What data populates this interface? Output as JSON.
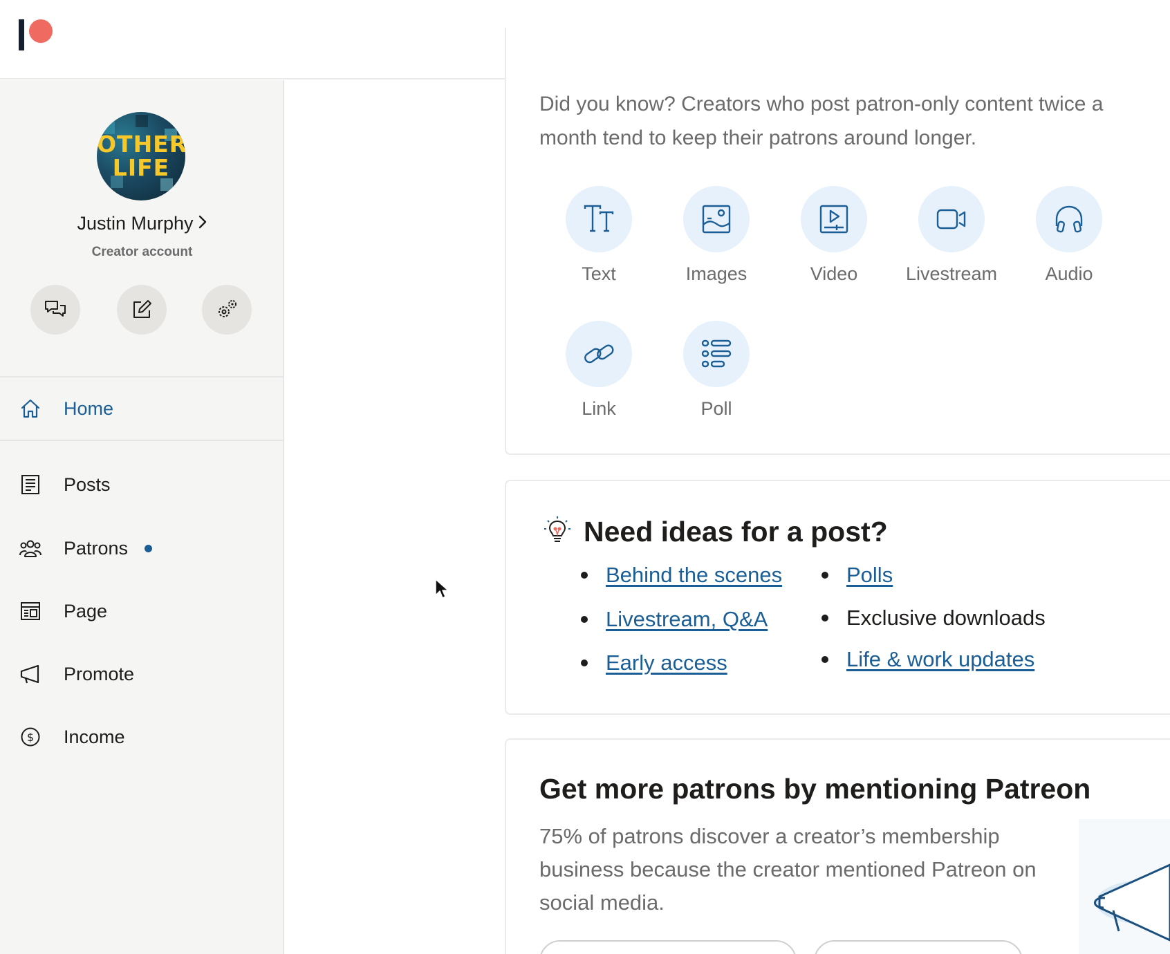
{
  "user": {
    "name": "Justin Murphy",
    "role": "Creator account",
    "avatar_text_line1": "OTHER",
    "avatar_text_line2": "LIFE"
  },
  "quick_actions": [
    "messages-icon",
    "edit-icon",
    "settings-icon"
  ],
  "nav": {
    "home": "Home",
    "posts": "Posts",
    "patrons": "Patrons",
    "page": "Page",
    "promote": "Promote",
    "income": "Income"
  },
  "create": {
    "did_you_know": "Did you know? Creators who post patron-only content twice a month tend to keep their patrons around longer.",
    "types": [
      "Text",
      "Images",
      "Video",
      "Livestream",
      "Audio",
      "Link",
      "Poll"
    ]
  },
  "ideas": {
    "title": "Need ideas for a post?",
    "items": [
      "Behind the scenes",
      "Livestream, Q&A",
      "Early access",
      "Polls",
      "Exclusive downloads",
      "Life & work updates"
    ]
  },
  "mention": {
    "title": "Get more patrons by mentioning Patreon",
    "body": "75% of patrons discover a creator’s membership business because the creator mentioned Patreon on social media."
  },
  "colors": {
    "accent": "#1b5e95",
    "brand_dot": "#ef6b61",
    "brand_bar": "#141f30",
    "icon_bg": "#e6f1fb"
  }
}
